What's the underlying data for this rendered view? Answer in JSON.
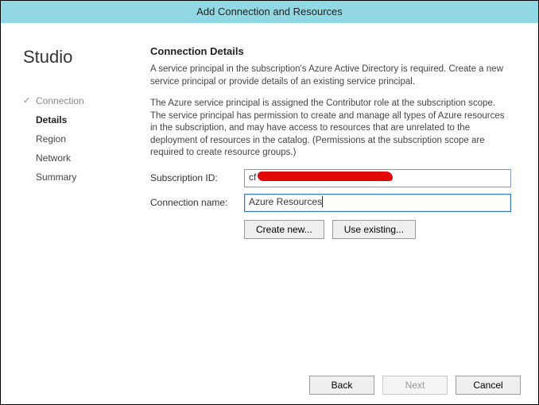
{
  "title": "Add Connection and Resources",
  "sidebar": {
    "brand": "Studio",
    "items": [
      {
        "label": "Connection",
        "state": "done"
      },
      {
        "label": "Details",
        "state": "current"
      },
      {
        "label": "Region",
        "state": "pending"
      },
      {
        "label": "Network",
        "state": "pending"
      },
      {
        "label": "Summary",
        "state": "pending"
      }
    ]
  },
  "main": {
    "heading": "Connection Details",
    "para1": "A service principal in the subscription's Azure Active Directory is required. Create a new service principal or provide details of an existing service principal.",
    "para2": "The Azure service principal is assigned the Contributor role at the subscription scope. The service principal has permission to create and manage all types of Azure resources in the subscription, and may have access to resources that are unrelated to the deployment of resources in the catalog. (Permissions at the subscription scope are required to create resource groups.)",
    "fields": {
      "subscription_id_label": "Subscription ID:",
      "subscription_id_prefix": "cf",
      "connection_name_label": "Connection name:",
      "connection_name_value": "Azure Resources"
    },
    "buttons": {
      "create_new": "Create new...",
      "use_existing": "Use existing..."
    }
  },
  "footer": {
    "back": "Back",
    "next": "Next",
    "cancel": "Cancel",
    "next_enabled": false
  }
}
